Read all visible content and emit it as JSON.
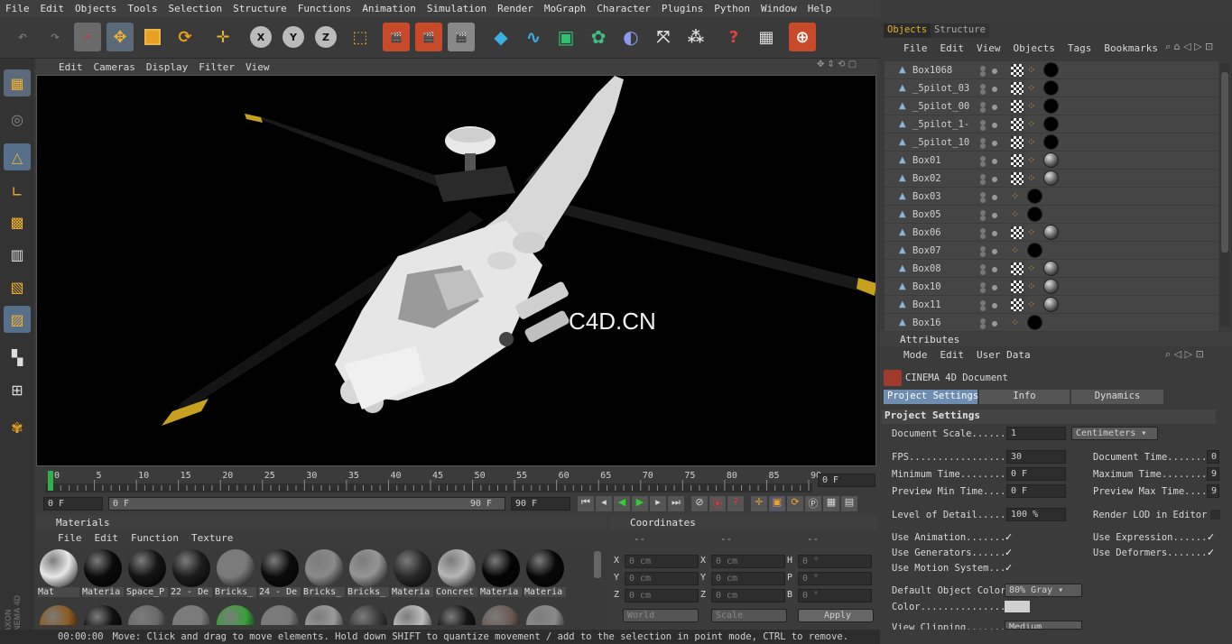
{
  "menu": [
    "File",
    "Edit",
    "Objects",
    "Tools",
    "Selection",
    "Structure",
    "Functions",
    "Animation",
    "Simulation",
    "Render",
    "MoGraph",
    "Character",
    "Plugins",
    "Python",
    "Window",
    "Help"
  ],
  "viewport": {
    "menu": [
      "Edit",
      "Cameras",
      "Display",
      "Filter",
      "View"
    ],
    "watermark": "C4D.CN"
  },
  "timeline": {
    "ticks": [
      "0",
      "5",
      "10",
      "15",
      "20",
      "25",
      "30",
      "35",
      "40",
      "45",
      "50",
      "55",
      "60",
      "65",
      "70",
      "75",
      "80",
      "85",
      "90"
    ],
    "current_frame": "0 F",
    "start_field": "0 F",
    "range_start": "0 F",
    "range_end": "90 F",
    "end_field": "90 F"
  },
  "materials": {
    "title": "Materials",
    "menu": [
      "File",
      "Edit",
      "Function",
      "Texture"
    ],
    "items": [
      {
        "label": "Mat",
        "color": "#e8e8e8"
      },
      {
        "label": "Materia",
        "color": "#0a0a0a"
      },
      {
        "label": "Space_P",
        "color": "#141414"
      },
      {
        "label": "22 - De",
        "color": "#1c1c1c"
      },
      {
        "label": "Bricks_",
        "color": "#7a7a7a"
      },
      {
        "label": "24 - De",
        "color": "#0c0c0c"
      },
      {
        "label": "Bricks_",
        "color": "#8a8a8a"
      },
      {
        "label": "Bricks_",
        "color": "#959595"
      },
      {
        "label": "Materia",
        "color": "#2a2a2a"
      },
      {
        "label": "Concret",
        "color": "#b5b5b5"
      },
      {
        "label": "Materia",
        "color": "#050505"
      },
      {
        "label": "Materia",
        "color": "#080808"
      }
    ],
    "row2_colors": [
      "#8a5a20",
      "#101010",
      "#6a6a6a",
      "#7a7a7a",
      "#3aa03a",
      "#787878",
      "#9a9a9a",
      "#3a3a3a",
      "#bdbdbd",
      "#151515",
      "#6a5a50",
      "#8a8a8a"
    ]
  },
  "coordinates": {
    "title": "Coordinates",
    "headers": [
      "--",
      "--",
      "--"
    ],
    "rows": [
      {
        "a": "X",
        "av": "0 cm",
        "b": "X",
        "bv": "0 cm",
        "c": "H",
        "cv": "0 °"
      },
      {
        "a": "Y",
        "av": "0 cm",
        "b": "Y",
        "bv": "0 cm",
        "c": "P",
        "cv": "0 °"
      },
      {
        "a": "Z",
        "av": "0 cm",
        "b": "Z",
        "bv": "0 cm",
        "c": "B",
        "cv": "0 °"
      }
    ],
    "mode": "World",
    "scale": "Scale",
    "apply": "Apply"
  },
  "objects_panel": {
    "tabs": [
      "Objects",
      "Structure"
    ],
    "menu": [
      "File",
      "Edit",
      "View",
      "Objects",
      "Tags",
      "Bookmarks"
    ],
    "rows": [
      {
        "name": "Box1068",
        "tags": "full"
      },
      {
        "name": "_5pilot_03",
        "tags": "full"
      },
      {
        "name": "_5pilot_00",
        "tags": "full"
      },
      {
        "name": "_5pilot_1-",
        "tags": "full"
      },
      {
        "name": "_5pilot_10",
        "tags": "full"
      },
      {
        "name": "Box01",
        "tags": "grey"
      },
      {
        "name": "Box02",
        "tags": "grey"
      },
      {
        "name": "Box03",
        "tags": "short"
      },
      {
        "name": "Box05",
        "tags": "short"
      },
      {
        "name": "Box06",
        "tags": "grey"
      },
      {
        "name": "Box07",
        "tags": "short"
      },
      {
        "name": "Box08",
        "tags": "grey"
      },
      {
        "name": "Box10",
        "tags": "grey"
      },
      {
        "name": "Box11",
        "tags": "grey"
      },
      {
        "name": "Box16",
        "tags": "short"
      }
    ]
  },
  "attributes": {
    "title": "Attributes",
    "menu": [
      "Mode",
      "Edit",
      "User Data"
    ],
    "doc_title": "CINEMA 4D Document",
    "tabs": [
      "Project Settings",
      "Info",
      "Dynamics"
    ],
    "section": "Project Settings",
    "doc_scale_label": "Document Scale......",
    "doc_scale_value": "1",
    "doc_scale_unit": "Centimeters",
    "fps_label": "FPS.................",
    "fps_value": "30",
    "min_time_label": "Minimum Time........",
    "min_time_value": "0 F",
    "prev_min_label": "Preview Min Time....",
    "prev_min_value": "0 F",
    "doc_time_label": "Document Time.......",
    "doc_time_value": "0",
    "max_time_label": "Maximum Time........",
    "max_time_value": "9",
    "prev_max_label": "Preview Max Time....",
    "prev_max_value": "9",
    "lod_label": "Level of Detail.....",
    "lod_value": "100 %",
    "render_lod_label": "Render LOD in Editor",
    "use_anim": "Use Animation.......",
    "use_gen": "Use Generators......",
    "use_motion": "Use Motion System...",
    "use_expr": "Use Expression......",
    "use_deform": "Use Deformers.......",
    "def_color_label": "Default Object Color",
    "def_color_value": "80% Gray",
    "color_label": "Color...............",
    "clipping_label": "View Clipping.......",
    "clipping_value": "Medium"
  },
  "status": {
    "time": "00:00:00",
    "message": "Move: Click and drag to move elements. Hold down SHIFT to quantize movement / add to the selection in point mode, CTRL to remove."
  },
  "brand": {
    "line1": "MAXON",
    "line2": "CINEMA 4D"
  },
  "colors": {
    "accent": "#5a6a7a",
    "selected_tab": "#6f8db0",
    "playhead": "#2fb04a",
    "rotor_tip": "#c8a020"
  }
}
